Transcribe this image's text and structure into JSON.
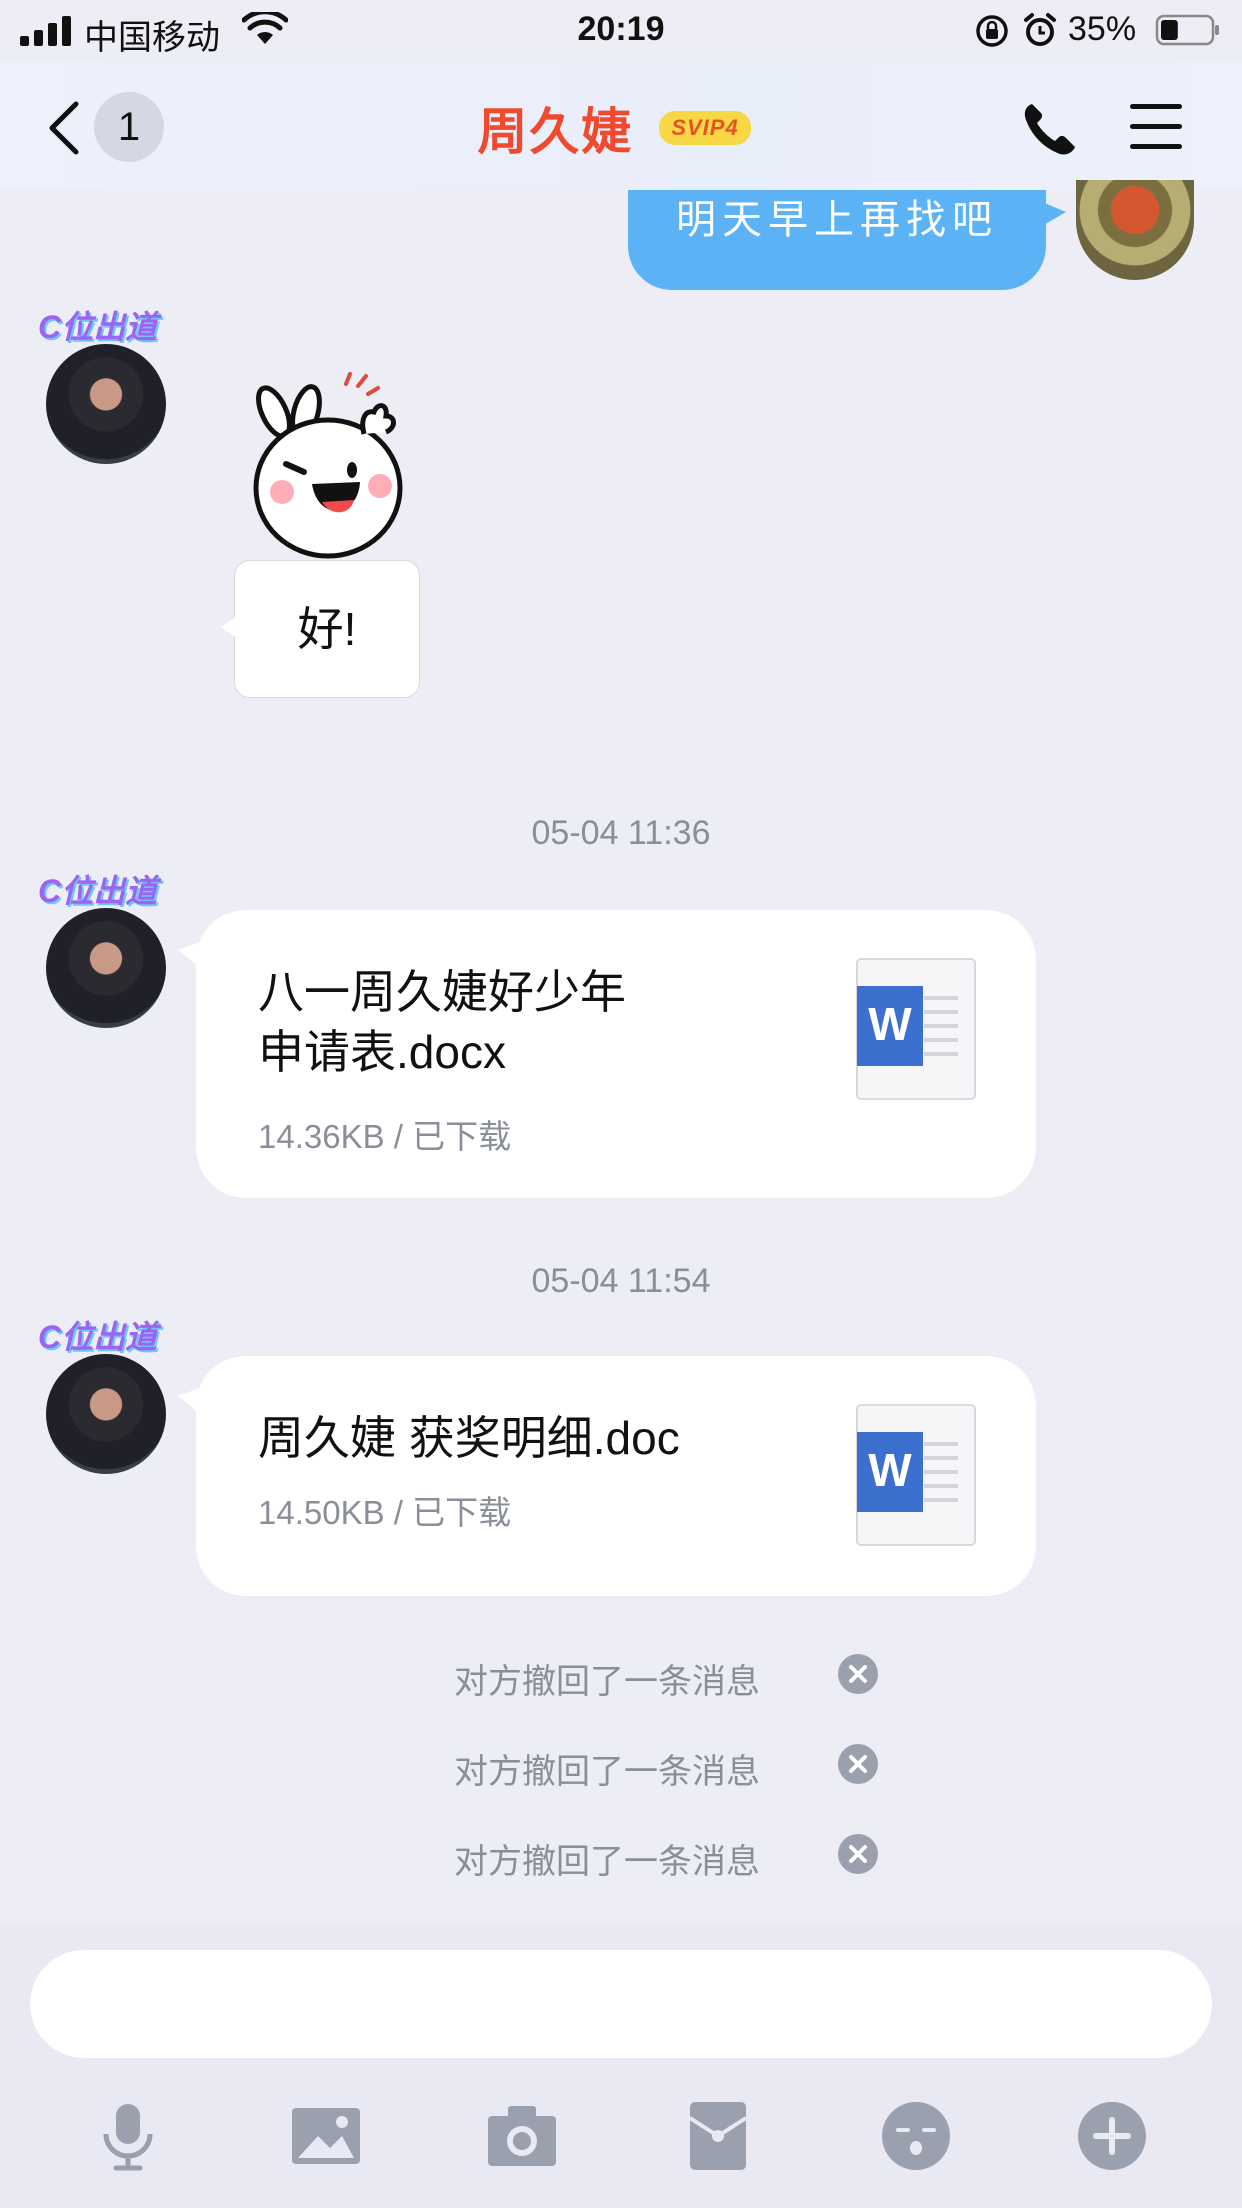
{
  "status_bar": {
    "carrier": "中国移动",
    "time": "20:19",
    "battery_percent": "35%",
    "battery_level": 0.35
  },
  "nav": {
    "back_count": "1",
    "title": "周久婕",
    "vip_badge": "SVIP4"
  },
  "messages": {
    "outgoing_text": "明天早上再找吧",
    "sticker_caption": "好!",
    "timestamps": [
      "05-04 11:36",
      "05-04 11:54"
    ],
    "files": [
      {
        "name_line1": "八一周久婕好少年",
        "name_line2": "申请表.docx",
        "meta": "14.36KB / 已下载",
        "icon": "word-doc-icon"
      },
      {
        "name_line1": "周久婕 获奖明细.doc",
        "meta": "14.50KB / 已下载",
        "icon": "word-doc-icon"
      }
    ],
    "recalled": [
      "对方撤回了一条消息",
      "对方撤回了一条消息",
      "对方撤回了一条消息"
    ]
  },
  "input": {
    "placeholder": ""
  },
  "toolbar": [
    "microphone-icon",
    "image-icon",
    "camera-icon",
    "red-packet-icon",
    "emoji-icon",
    "plus-icon"
  ],
  "colors": {
    "accent_blue": "#5bb3f5",
    "title_red": "#f0492e",
    "vip_yellow": "#f8d745",
    "word_blue": "#3d6fcf"
  }
}
